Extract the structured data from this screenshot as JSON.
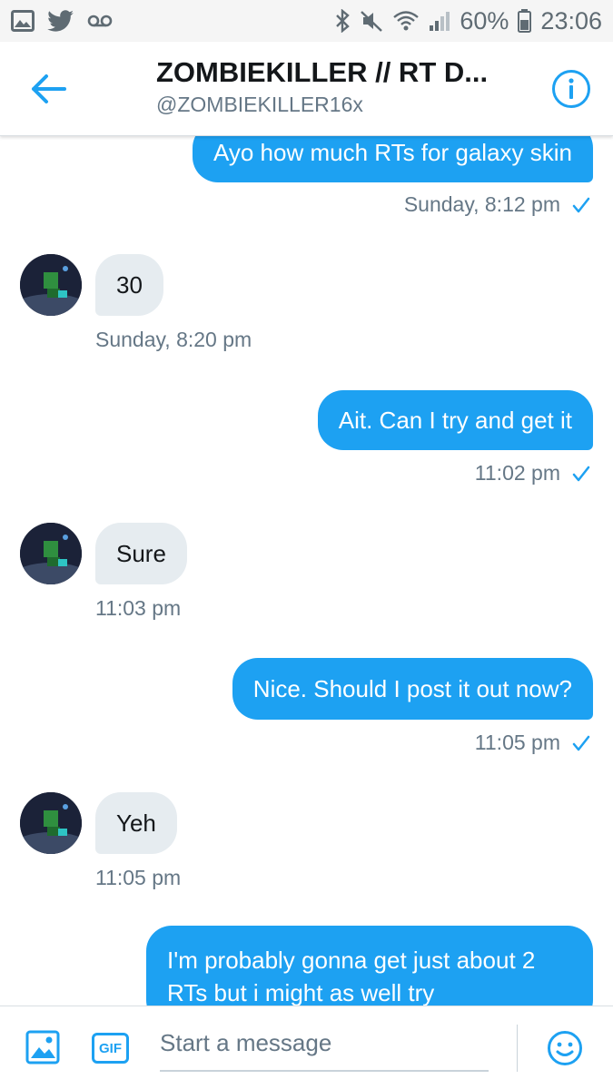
{
  "status_bar": {
    "icons_left": [
      "gallery-icon",
      "twitter-bird-icon",
      "voicemail-icon"
    ],
    "icons_right": [
      "bluetooth-icon",
      "mute-icon",
      "wifi-icon",
      "signal-icon",
      "battery-icon"
    ],
    "battery": "60%",
    "time": "23:06"
  },
  "header": {
    "title": "ZOMBIEKILLER // RT D...",
    "handle": "@ZOMBIEKILLER16x"
  },
  "messages": [
    {
      "type": "sent",
      "text": "Ayo how much RTs for galaxy skin",
      "time": "Sunday, 8:12 pm"
    },
    {
      "type": "received",
      "text": "30",
      "time": "Sunday, 8:20 pm"
    },
    {
      "type": "sent",
      "text": "Ait. Can I try and get it",
      "time": "11:02 pm"
    },
    {
      "type": "received",
      "text": "Sure",
      "time": "11:03 pm"
    },
    {
      "type": "sent",
      "text": "Nice. Should I post it out now?",
      "time": "11:05 pm"
    },
    {
      "type": "received",
      "text": "Yeh",
      "time": "11:05 pm"
    },
    {
      "type": "sent",
      "text": "I'm probably gonna get just about 2 RTs but i might as well try",
      "time": ""
    }
  ],
  "composer": {
    "placeholder": "Start a message",
    "gif_label": "GIF"
  },
  "colors": {
    "accent": "#1da1f2",
    "received_bubble": "#e6ecf0",
    "muted_text": "#657786"
  }
}
